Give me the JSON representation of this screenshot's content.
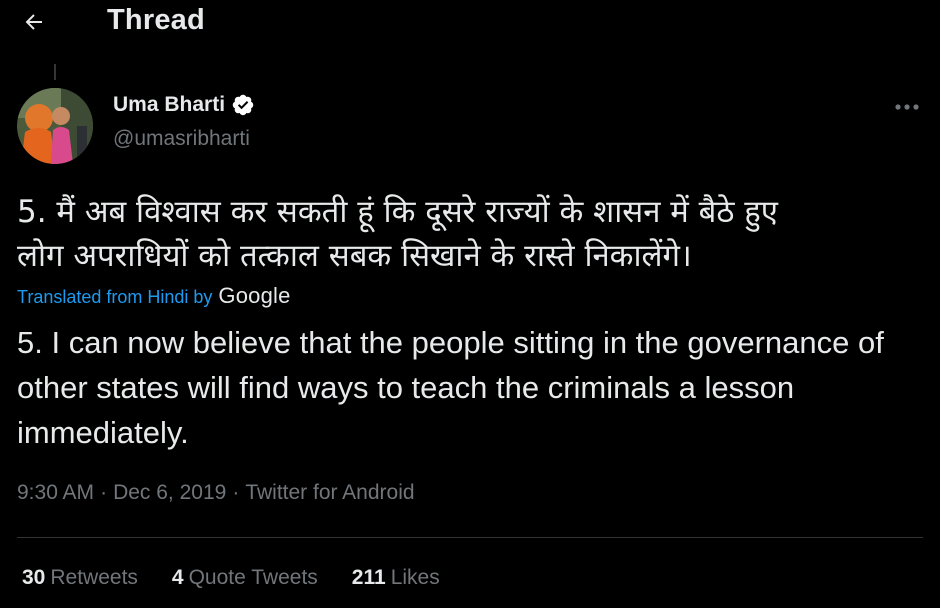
{
  "header": {
    "title": "Thread",
    "back_icon": "arrow-left-icon"
  },
  "author": {
    "name": "Uma Bharti",
    "handle": "@umasribharti",
    "verified": true,
    "verified_color": "#ffffff"
  },
  "tweet": {
    "text_line1": "5. मैं अब विश्वास कर सकती हूं कि दूसरे राज्यों के शासन में बैठे हुए",
    "text_line2": "लोग अपराधियों को तत्काल सबक सिखाने के रास्ते निकालेंगे।",
    "translated_label": "Translated from Hindi by",
    "translator": "Google",
    "translation": "5. I can now believe that the people sitting in the governance of other states will find ways to teach the criminals a lesson immediately.",
    "time": "9:30 AM",
    "date": "Dec 6, 2019",
    "source": "Twitter for Android",
    "separator": "·"
  },
  "stats": {
    "retweets_count": "30",
    "retweets_label": "Retweets",
    "quotes_count": "4",
    "quotes_label": "Quote Tweets",
    "likes_count": "211",
    "likes_label": "Likes"
  },
  "colors": {
    "background": "#000000",
    "text": "#e7e9ea",
    "secondary": "#71767b",
    "link": "#1d9bf0",
    "divider": "#2f3336"
  }
}
